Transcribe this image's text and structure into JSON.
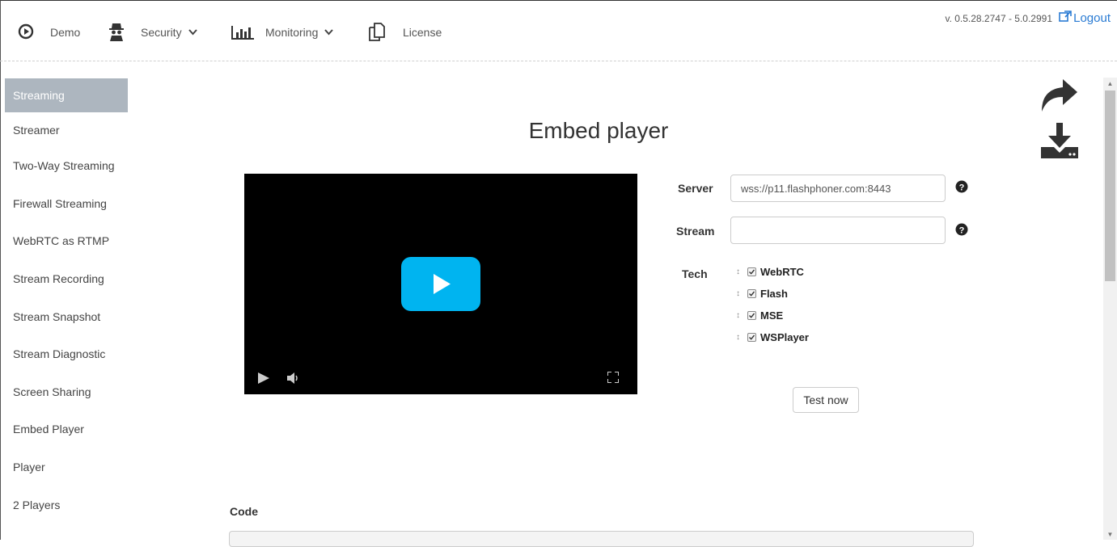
{
  "nav": {
    "demo": "Demo",
    "security": "Security",
    "monitoring": "Monitoring",
    "license": "License",
    "version": "v. 0.5.28.2747 - 5.0.2991",
    "logout": "Logout"
  },
  "sidebar": {
    "items": [
      {
        "label": "Streaming",
        "active": true
      },
      {
        "label": "Streamer"
      },
      {
        "label": "Two-Way Streaming"
      },
      {
        "label": "Firewall Streaming"
      },
      {
        "label": "WebRTC as RTMP"
      },
      {
        "label": "Stream Recording"
      },
      {
        "label": "Stream Snapshot"
      },
      {
        "label": "Stream Diagnostic"
      },
      {
        "label": "Screen Sharing"
      },
      {
        "label": "Embed Player"
      },
      {
        "label": "Player"
      },
      {
        "label": "2 Players"
      }
    ]
  },
  "main": {
    "title": "Embed player",
    "server_label": "Server",
    "server_value": "wss://p11.flashphoner.com:8443",
    "stream_label": "Stream",
    "stream_value": "",
    "tech_label": "Tech",
    "tech_options": [
      {
        "label": "WebRTC",
        "checked": true
      },
      {
        "label": "Flash",
        "checked": true
      },
      {
        "label": "MSE",
        "checked": true
      },
      {
        "label": "WSPlayer",
        "checked": true
      }
    ],
    "test_button": "Test now",
    "code_label": "Code"
  },
  "icons": {
    "demo": "play-circle-icon",
    "security": "spy-icon",
    "monitoring": "bar-chart-icon",
    "license": "documents-icon",
    "logout": "external-link-icon",
    "share": "share-arrow-icon",
    "download": "download-icon",
    "help": "question-circle-icon"
  },
  "colors": {
    "accent": "#2a7bd3",
    "sidebar_active": "#adb6bf",
    "play_button": "#00b4f0"
  }
}
